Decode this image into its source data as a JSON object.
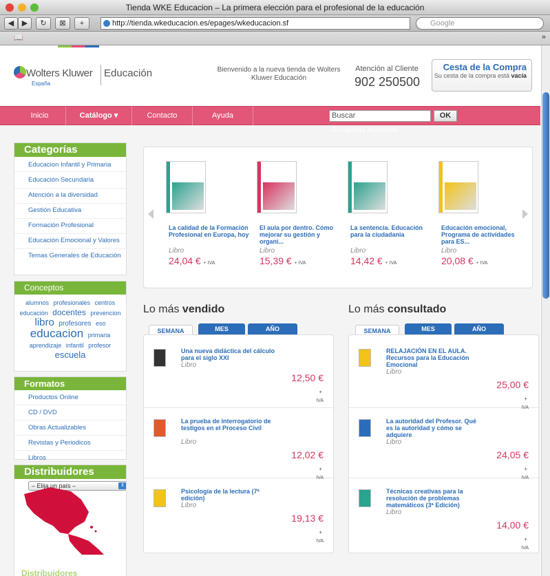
{
  "browser": {
    "title": "Tienda WKE Educacion – La primera elección para el profesional de la educación",
    "url": "http://tienda.wkeducacion.es/epages/wkeducacion.sf",
    "search_placeholder": "Google",
    "bookmark_icon": "book-icon"
  },
  "header": {
    "logo_name": "Wolters Kluwer",
    "logo_sub": "Educación",
    "logo_country": "España",
    "welcome": "Bienvenido a la nueva tienda de Wolters Kluwer Educación",
    "attention_label": "Atención al Cliente",
    "phone": "902 250500",
    "cart_title": "Cesta de la Compra",
    "cart_sub": "Su cesta de la compra está",
    "cart_state": "vacía"
  },
  "nav": {
    "items": [
      "Inicio",
      "Catálogo ▾",
      "Contacto",
      "Ayuda"
    ],
    "search_value": "Buscar",
    "ok": "OK",
    "advanced": "Búsqueda Avanzada"
  },
  "sidebar": {
    "categories_title": "Categorías",
    "categories": [
      "Educacion Infantil y Primaria",
      "Educación Secundaria",
      "Atención a la diversidad",
      "Gestión Educativa",
      "Formación Profesional",
      "Educación Emocional y Valores",
      "Temas Generales de Educación"
    ],
    "concepts_title": "Conceptos",
    "tags": [
      {
        "t": "alumnos",
        "s": 9
      },
      {
        "t": "profesionales",
        "s": 9
      },
      {
        "t": "centros",
        "s": 9
      },
      {
        "t": "educación",
        "s": 9
      },
      {
        "t": "docentes",
        "s": 12
      },
      {
        "t": "prevencion",
        "s": 9
      },
      {
        "t": "libro",
        "s": 15
      },
      {
        "t": "profesores",
        "s": 10
      },
      {
        "t": "eso",
        "s": 9
      },
      {
        "t": "educacion",
        "s": 17
      },
      {
        "t": "primaria",
        "s": 9
      },
      {
        "t": "aprendizaje",
        "s": 9
      },
      {
        "t": "infantil",
        "s": 9
      },
      {
        "t": "profesor",
        "s": 9
      },
      {
        "t": "escuela",
        "s": 13
      }
    ],
    "formats_title": "Formatos",
    "formats": [
      "Productos Online",
      "CD / DVD",
      "Obras Actualizables",
      "Revistas y Periodicos",
      "Libros"
    ],
    "dist_title": "Distribuidores",
    "country_select": "– Elija un país –",
    "dist_watermark": "Distribuidores"
  },
  "carousel": [
    {
      "title": "La calidad de la Formación Profesional en Europa, hoy",
      "type": "Libro",
      "price": "24,04 €",
      "iva": "+ IVA",
      "band": "#2aa38f"
    },
    {
      "title": "El aula por dentro. Cómo mejorar su gestión y organi...",
      "type": "Libro",
      "price": "15,39 €",
      "iva": "+ IVA",
      "band": "#d8345f"
    },
    {
      "title": "La sentencia. Educación para la ciudadanía",
      "type": "Libro",
      "price": "14,42 €",
      "iva": "+ IVA",
      "band": "#2aa38f"
    },
    {
      "title": "Educación emocional, Programa de actividades para ES...",
      "type": "Libro",
      "price": "20,08 €",
      "iva": "+ IVA",
      "band": "#f2c319"
    }
  ],
  "bestsellers": {
    "title_plain": "Lo más",
    "title_bold": "vendido",
    "tabs": [
      "SEMANA",
      "MES",
      "AÑO"
    ],
    "items": [
      {
        "title": "Una nueva didáctica del cálculo para el siglo XXI",
        "type": "Libro",
        "price": "12,50 €",
        "plus": "+",
        "iva": "IVA",
        "thumb": "#333"
      },
      {
        "title": "La prueba de interrogatorio de testigos en el Proceso Civil",
        "type": "Libro",
        "price": "12,02 €",
        "plus": "+",
        "iva": "IVA",
        "thumb": "#e05a2a"
      },
      {
        "title": "Psicología de la lectura (7ª edición)",
        "type": "Libro",
        "price": "19,13 €",
        "plus": "+",
        "iva": "IVA",
        "thumb": "#f2c319"
      }
    ]
  },
  "mostviewed": {
    "title_plain": "Lo más",
    "title_bold": "consultado",
    "tabs": [
      "SEMANA",
      "MES",
      "AÑO"
    ],
    "items": [
      {
        "title": "RELAJACIÓN EN EL AULA. Recursos para la Educación Emocional",
        "type": "Libro",
        "price": "25,00 €",
        "plus": "+",
        "iva": "IVA",
        "thumb": "#f2c319"
      },
      {
        "title": "La autoridad del Profesor. Qué es la autoridad y cómo se adquiere",
        "type": "Libro",
        "price": "24,05 €",
        "plus": "+",
        "iva": "IVA",
        "thumb": "#2b6db8"
      },
      {
        "title": "Técnicas creativas para la resolución de problemas matemáticos (3ª Edición)",
        "type": "Libro",
        "price": "14,00 €",
        "plus": "+",
        "iva": "IVA",
        "thumb": "#2aa38f"
      }
    ]
  }
}
